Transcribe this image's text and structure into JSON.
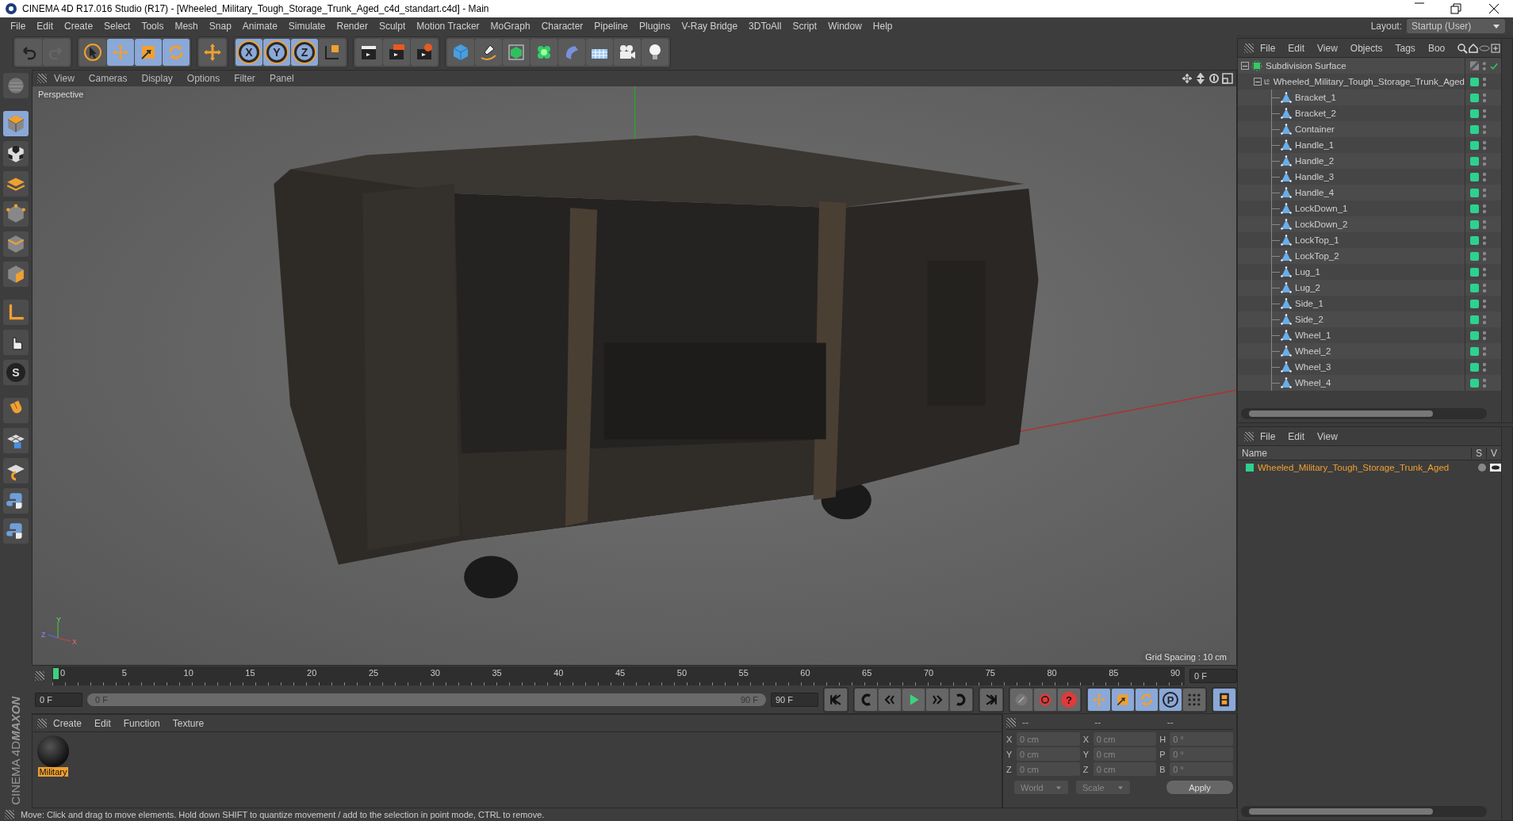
{
  "window": {
    "title": "CINEMA 4D R17.016 Studio (R17) - [Wheeled_Military_Tough_Storage_Trunk_Aged_c4d_standart.c4d] - Main"
  },
  "menu": [
    "File",
    "Edit",
    "Create",
    "Select",
    "Tools",
    "Mesh",
    "Snap",
    "Animate",
    "Simulate",
    "Render",
    "Sculpt",
    "Motion Tracker",
    "MoGraph",
    "Character",
    "Pipeline",
    "Plugins",
    "V-Ray Bridge",
    "3DToAll",
    "Script",
    "Window",
    "Help"
  ],
  "layout": {
    "label": "Layout:",
    "value": "Startup (User)"
  },
  "toolbar": [
    {
      "items": [
        {
          "kind": "undo",
          "active": false
        },
        {
          "kind": "redo",
          "active": false
        }
      ]
    },
    {
      "items": [
        {
          "kind": "select",
          "active": false
        },
        {
          "kind": "move",
          "active": true
        },
        {
          "kind": "scale",
          "active": true
        },
        {
          "kind": "rotate",
          "active": true
        }
      ]
    },
    {
      "items": [
        {
          "kind": "move-add",
          "active": false
        }
      ]
    },
    {
      "items": [
        {
          "kind": "axis",
          "label": "X",
          "active": true
        },
        {
          "kind": "axis",
          "label": "Y",
          "active": true
        },
        {
          "kind": "axis",
          "label": "Z",
          "active": true
        },
        {
          "kind": "coords",
          "active": false
        }
      ]
    },
    {
      "items": [
        {
          "kind": "render-view",
          "active": false
        },
        {
          "kind": "render",
          "active": false
        },
        {
          "kind": "render-settings",
          "active": false
        }
      ]
    },
    {
      "items": [
        {
          "kind": "cube",
          "active": false
        },
        {
          "kind": "pen",
          "active": false
        },
        {
          "kind": "subdiv",
          "active": false
        },
        {
          "kind": "cloner",
          "active": false
        },
        {
          "kind": "deformer",
          "active": false
        },
        {
          "kind": "floor",
          "active": false
        },
        {
          "kind": "camera",
          "active": false
        },
        {
          "kind": "light",
          "active": false
        }
      ]
    }
  ],
  "tools": [
    {
      "kind": "editable",
      "active": false
    },
    {
      "kind": "model",
      "active": true
    },
    {
      "kind": "texture",
      "active": false
    },
    {
      "kind": "workplane",
      "active": false
    },
    {
      "kind": "points",
      "active": false
    },
    {
      "kind": "edges",
      "active": false
    },
    {
      "kind": "polys",
      "active": false
    },
    {
      "kind": "axis-l",
      "active": false
    },
    {
      "kind": "tweak",
      "active": false
    },
    {
      "kind": "solo",
      "label": "S",
      "active": false
    },
    {
      "kind": "magnet",
      "active": false
    },
    {
      "kind": "snap",
      "active": false
    },
    {
      "kind": "snap-settings",
      "active": false
    },
    {
      "kind": "python",
      "active": false
    },
    {
      "kind": "python",
      "active": false
    }
  ],
  "viewport": {
    "menu": [
      "View",
      "Cameras",
      "Display",
      "Options",
      "Filter",
      "Panel"
    ],
    "camera": "Perspective",
    "grid": "Grid Spacing : 10 cm",
    "gizmo": [
      "Y",
      "Z",
      "X"
    ]
  },
  "timeline": {
    "ticks": [
      "0",
      "5",
      "10",
      "15",
      "20",
      "25",
      "30",
      "35",
      "40",
      "45",
      "50",
      "55",
      "60",
      "65",
      "70",
      "75",
      "80",
      "85",
      "90"
    ],
    "level": 0,
    "current": "0 F",
    "start": "0 F",
    "range_start": "0 F",
    "range_end": "90 F",
    "end": "90 F"
  },
  "transport": [
    {
      "kind": "first",
      "active": false
    },
    {
      "kind": "prev-key",
      "active": false
    },
    {
      "kind": "prev-frame",
      "active": false
    },
    {
      "kind": "play",
      "active": false
    },
    {
      "kind": "next-frame",
      "active": false
    },
    {
      "kind": "next-key",
      "active": false
    },
    {
      "kind": "last",
      "active": false
    },
    {
      "kind": "record-off",
      "active": false
    },
    {
      "kind": "record",
      "active": false
    },
    {
      "kind": "help",
      "label": "?",
      "active": false
    },
    {
      "kind": "move",
      "active": true
    },
    {
      "kind": "scale",
      "active": true
    },
    {
      "kind": "rotate",
      "active": true
    },
    {
      "kind": "param",
      "label": "P",
      "active": true
    },
    {
      "kind": "dots",
      "active": false
    },
    {
      "kind": "film",
      "active": true
    }
  ],
  "materials": {
    "menu": [
      "Create",
      "Edit",
      "Function",
      "Texture"
    ],
    "items": [
      {
        "name": "Military",
        "selected": true
      }
    ]
  },
  "coords": {
    "headers": [
      "--",
      "--",
      "--"
    ],
    "columns": [
      [
        {
          "axis": "X",
          "value": "0 cm"
        },
        {
          "axis": "Y",
          "value": "0 cm"
        },
        {
          "axis": "Z",
          "value": "0 cm"
        }
      ],
      [
        {
          "axis": "X",
          "value": "0 cm"
        },
        {
          "axis": "Y",
          "value": "0 cm"
        },
        {
          "axis": "Z",
          "value": "0 cm"
        }
      ],
      [
        {
          "axis": "H",
          "value": "0 °"
        },
        {
          "axis": "P",
          "value": "0 °"
        },
        {
          "axis": "B",
          "value": "0 °"
        }
      ]
    ],
    "dropdowns": [
      "World",
      "Scale"
    ],
    "apply": "Apply"
  },
  "objects": {
    "menu": [
      "File",
      "Edit",
      "View",
      "Objects",
      "Tags",
      "Boo"
    ],
    "tree": [
      {
        "name": "Subdivision Surface",
        "kind": "subdivision",
        "expanded": true,
        "enabled": true,
        "children": [
          {
            "name": "Wheeled_Military_Tough_Storage_Trunk_Aged",
            "kind": "null",
            "expanded": true,
            "children": [
              {
                "name": "Bracket_1",
                "kind": "polygon"
              },
              {
                "name": "Bracket_2",
                "kind": "polygon"
              },
              {
                "name": "Container",
                "kind": "polygon"
              },
              {
                "name": "Handle_1",
                "kind": "polygon"
              },
              {
                "name": "Handle_2",
                "kind": "polygon"
              },
              {
                "name": "Handle_3",
                "kind": "polygon"
              },
              {
                "name": "Handle_4",
                "kind": "polygon"
              },
              {
                "name": "LockDown_1",
                "kind": "polygon"
              },
              {
                "name": "LockDown_2",
                "kind": "polygon"
              },
              {
                "name": "LockTop_1",
                "kind": "polygon"
              },
              {
                "name": "LockTop_2",
                "kind": "polygon"
              },
              {
                "name": "Lug_1",
                "kind": "polygon"
              },
              {
                "name": "Lug_2",
                "kind": "polygon"
              },
              {
                "name": "Side_1",
                "kind": "polygon"
              },
              {
                "name": "Side_2",
                "kind": "polygon"
              },
              {
                "name": "Wheel_1",
                "kind": "polygon"
              },
              {
                "name": "Wheel_2",
                "kind": "polygon"
              },
              {
                "name": "Wheel_3",
                "kind": "polygon"
              },
              {
                "name": "Wheel_4",
                "kind": "polygon"
              }
            ]
          }
        ]
      }
    ]
  },
  "layers": {
    "menu": [
      "File",
      "Edit",
      "View"
    ],
    "columns": [
      "Name",
      "S",
      "V"
    ],
    "rows": [
      {
        "name": "Wheeled_Military_Tough_Storage_Trunk_Aged",
        "selected": true
      }
    ]
  },
  "logo": [
    "MAXON",
    "CINEMA 4D"
  ],
  "status": "Move: Click and drag to move elements. Hold down SHIFT to quantize movement / add to the selection in point mode, CTRL to remove."
}
